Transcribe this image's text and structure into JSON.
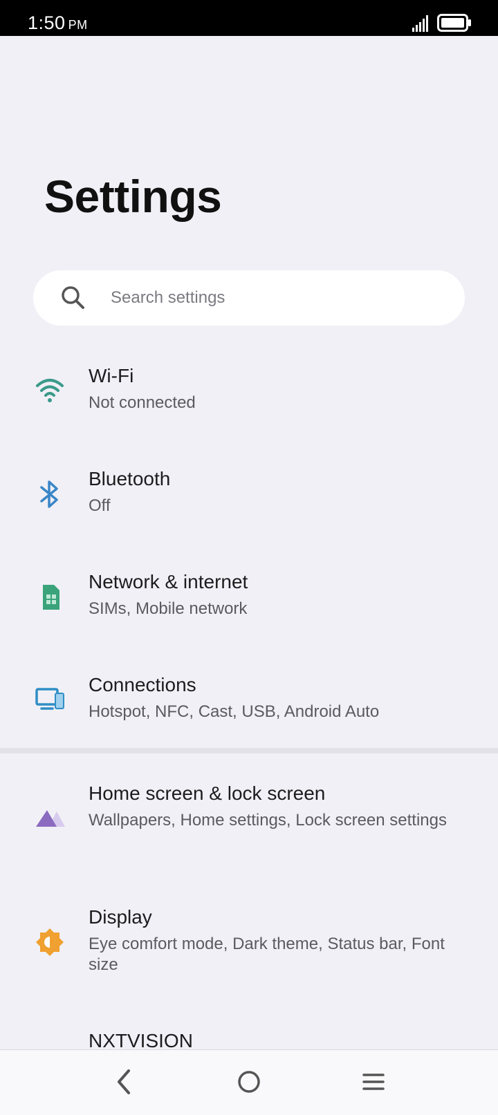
{
  "status_bar": {
    "time": "1:50",
    "ampm": "PM"
  },
  "page": {
    "title": "Settings"
  },
  "search": {
    "placeholder": "Search settings"
  },
  "settings_items": [
    {
      "title": "Wi-Fi",
      "subtitle": "Not connected",
      "icon": "wifi-icon",
      "color": "#3a9a8a"
    },
    {
      "title": "Bluetooth",
      "subtitle": "Off",
      "icon": "bluetooth-icon",
      "color": "#3a86c8"
    },
    {
      "title": "Network & internet",
      "subtitle": "SIMs, Mobile network",
      "icon": "sim-card-icon",
      "color": "#3aa37a"
    },
    {
      "title": "Connections",
      "subtitle": "Hotspot, NFC, Cast, USB, Android Auto",
      "icon": "devices-icon",
      "color": "#2f8ec5"
    },
    {
      "title": "Home screen & lock screen",
      "subtitle": "Wallpapers, Home settings, Lock screen settings",
      "icon": "wallpaper-icon",
      "color": "#8a6bc0"
    },
    {
      "title": "Display",
      "subtitle": "Eye comfort mode, Dark theme, Status bar, Font size",
      "icon": "brightness-icon",
      "color": "#f0a030"
    },
    {
      "title": "NXTVISION",
      "subtitle": "",
      "icon": "nxtvision-icon",
      "color": "#e04060"
    }
  ],
  "nav_bar": {
    "buttons": [
      "back-icon",
      "home-icon",
      "menu-icon"
    ]
  }
}
